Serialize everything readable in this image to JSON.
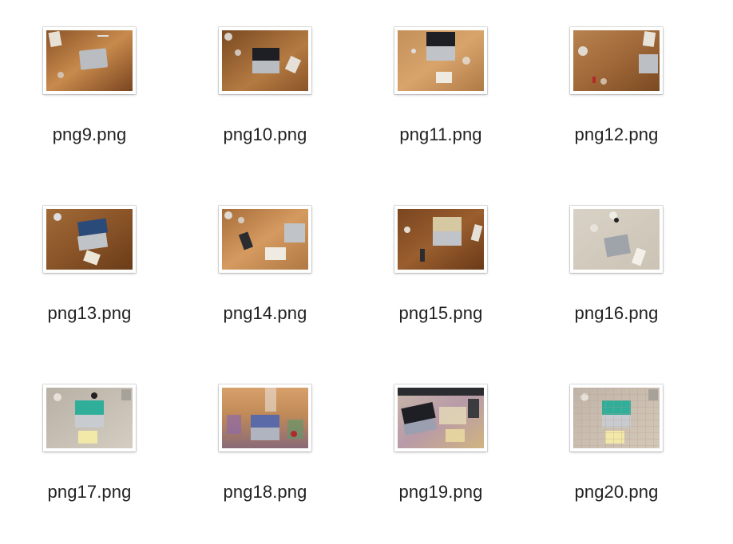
{
  "files": [
    {
      "name": "png9.png",
      "thumb": "wood-a",
      "icon": "desk-photo-icon"
    },
    {
      "name": "png10.png",
      "thumb": "wood-b",
      "icon": "desk-photo-icon"
    },
    {
      "name": "png11.png",
      "thumb": "wood-c",
      "icon": "desk-photo-icon"
    },
    {
      "name": "png12.png",
      "thumb": "wood-d",
      "icon": "desk-photo-icon"
    },
    {
      "name": "png13.png",
      "thumb": "wood-e",
      "icon": "desk-photo-icon"
    },
    {
      "name": "png14.png",
      "thumb": "wood-f",
      "icon": "desk-photo-icon"
    },
    {
      "name": "png15.png",
      "thumb": "wood-g",
      "icon": "desk-photo-icon"
    },
    {
      "name": "png16.png",
      "thumb": "beige-a",
      "icon": "desk-photo-icon"
    },
    {
      "name": "png17.png",
      "thumb": "beige-b",
      "icon": "desk-photo-icon"
    },
    {
      "name": "png18.png",
      "thumb": "glitch-a",
      "icon": "desk-photo-icon"
    },
    {
      "name": "png19.png",
      "thumb": "glitch-b",
      "icon": "desk-photo-icon"
    },
    {
      "name": "png20.png",
      "thumb": "grid-a",
      "icon": "desk-photo-icon"
    }
  ],
  "colors": {
    "label_text": "#222222",
    "background": "#ffffff",
    "wood_dark": "#7a4a22",
    "wood_light": "#c58a4e",
    "beige": "#d9d2c6",
    "laptop_silver": "#b8bcc2",
    "screen_dark": "#1d1f24",
    "screen_teal": "#2fae9a"
  }
}
